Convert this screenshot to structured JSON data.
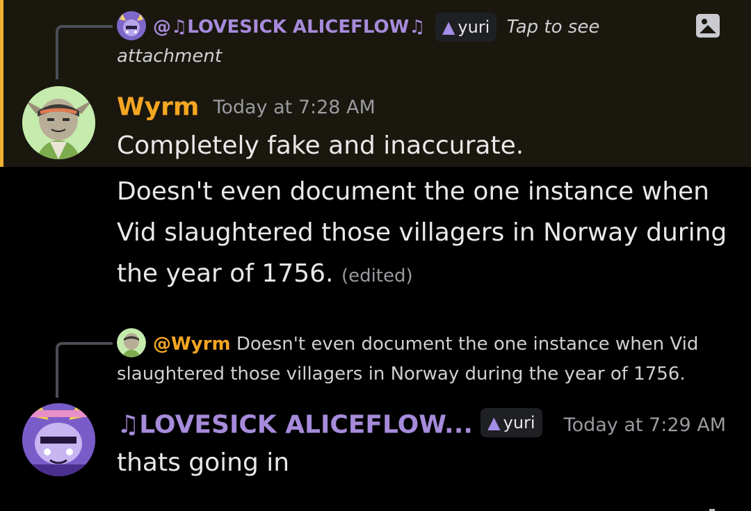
{
  "message1": {
    "reply": {
      "mention": "@",
      "author": "♫LOVESICK ALICEFLOW♫",
      "role": {
        "label": "yuri"
      },
      "text_line1": "Tap to see",
      "text_line2": "attachment",
      "attachment_icon": "image-icon"
    },
    "author": "Wyrm",
    "author_color": "#f5a623",
    "timestamp": "Today at 7:28 AM",
    "content": "Completely fake and inaccurate.",
    "highlight_color": "#f0b232"
  },
  "message2": {
    "content": "Doesn't even document the one instance when Vid slaughtered those villagers in Norway during the year of 1756.",
    "edited_label": "(edited)"
  },
  "message3": {
    "reply": {
      "mention": "@Wyrm",
      "text_line1": "Doesn't even document the one instance when Vid",
      "text_line2": "slaughtered those villagers in Norway during the year of 1756."
    },
    "author": "♫LOVESICK ALICEFLOW...",
    "author_color": "#a78bdb",
    "role": {
      "label": "yuri"
    },
    "timestamp": "Today at 7:29 AM",
    "content": "thats going in"
  }
}
